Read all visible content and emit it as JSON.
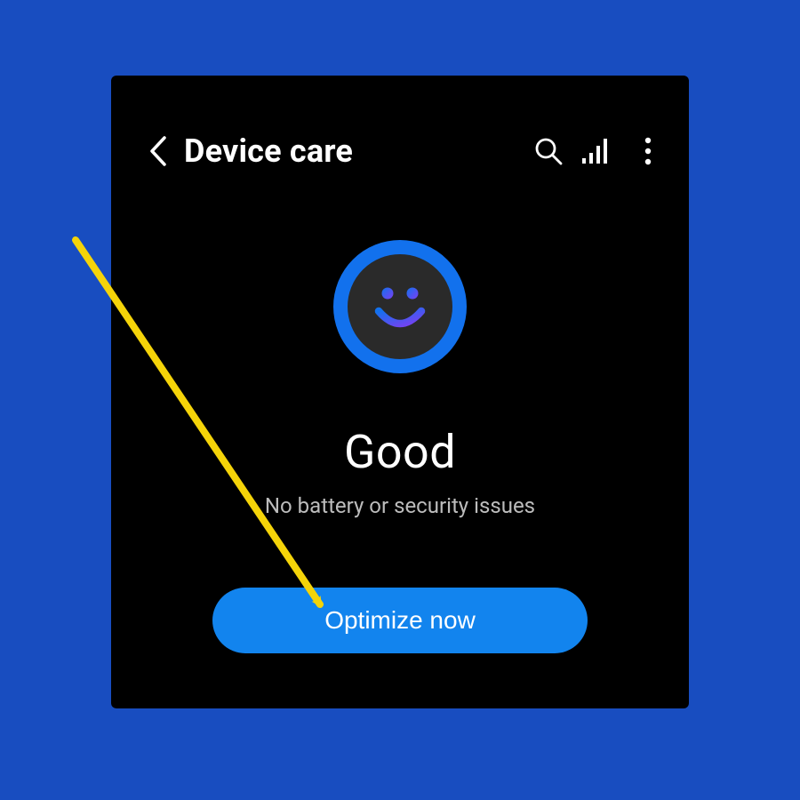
{
  "header": {
    "title": "Device care"
  },
  "status": {
    "headline": "Good",
    "subtext": "No battery or security issues"
  },
  "actions": {
    "optimize_label": "Optimize now"
  }
}
